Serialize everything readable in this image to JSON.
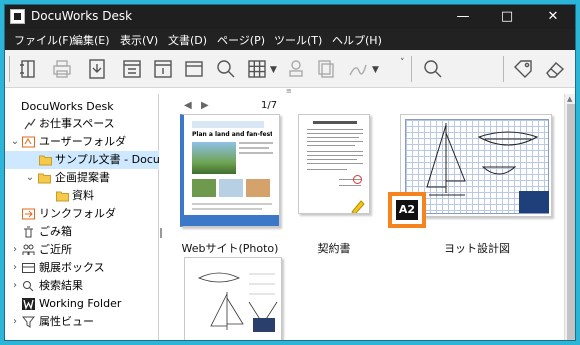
{
  "window": {
    "title": "DocuWorks Desk"
  },
  "menubar": {
    "items": [
      {
        "label": "ファイル(F)"
      },
      {
        "label": "編集(E)"
      },
      {
        "label": "表示(V)"
      },
      {
        "label": "文書(D)"
      },
      {
        "label": "ページ(P)"
      },
      {
        "label": "ツール(T)"
      },
      {
        "label": "ヘルプ(H)"
      }
    ]
  },
  "toolbar": {
    "tools": [
      {
        "name": "scan-icon"
      },
      {
        "name": "print-icon"
      },
      {
        "name": "download-icon"
      },
      {
        "name": "viewer-icon"
      },
      {
        "name": "info-icon"
      },
      {
        "name": "window-icon"
      },
      {
        "name": "search-icon"
      },
      {
        "name": "grid-icon"
      },
      {
        "name": "stamp-icon"
      },
      {
        "name": "copy-icon"
      },
      {
        "name": "sign-icon"
      },
      {
        "name": "search-icon"
      },
      {
        "name": "tag-icon"
      },
      {
        "name": "eraser-icon"
      }
    ]
  },
  "sidebar": {
    "root": "DocuWorks Desk",
    "items": [
      {
        "label": "お仕事スペース"
      },
      {
        "label": "ユーザーフォルダ"
      },
      {
        "label": "サンプル文書 - DocuWo"
      },
      {
        "label": "企画提案書"
      },
      {
        "label": "資料"
      },
      {
        "label": "リンクフォルダ"
      },
      {
        "label": "ごみ箱"
      },
      {
        "label": "ご近所"
      },
      {
        "label": "親展ボックス"
      },
      {
        "label": "検索結果"
      },
      {
        "label": "Working Folder"
      },
      {
        "label": "属性ビュー"
      }
    ]
  },
  "content": {
    "page_indicator": "1/7",
    "documents": [
      {
        "label": "Webサイト(Photo)",
        "web_title": "Plan a land and fan-fest!"
      },
      {
        "label": "契約書"
      },
      {
        "label": "ヨット設計図"
      },
      {
        "label": ""
      }
    ],
    "badge": "A2"
  },
  "colors": {
    "accent": "#f5841f",
    "selection": "#cde8ff",
    "folder": "#f7c948",
    "titlebar": "#1f1f1f"
  }
}
